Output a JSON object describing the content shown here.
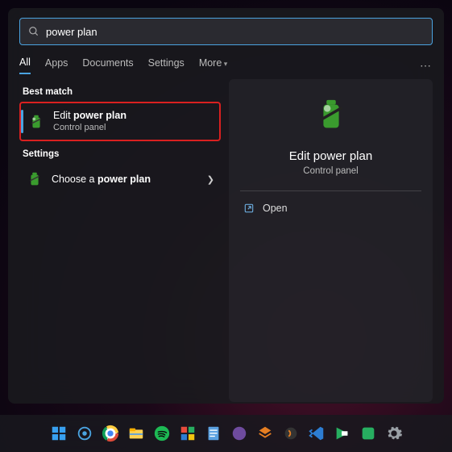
{
  "search": {
    "query": "power plan"
  },
  "tabs": {
    "all": "All",
    "apps": "Apps",
    "documents": "Documents",
    "settings": "Settings",
    "more": "More"
  },
  "sections": {
    "best_match": "Best match",
    "settings": "Settings"
  },
  "results": {
    "edit_plan": {
      "title_pre": "Edit ",
      "title_bold": "power plan",
      "subtitle": "Control panel"
    },
    "choose_plan": {
      "title_pre": "Choose a ",
      "title_bold": "power plan"
    }
  },
  "preview": {
    "title": "Edit power plan",
    "subtitle": "Control panel",
    "open": "Open"
  },
  "ellipsis": "⋯"
}
